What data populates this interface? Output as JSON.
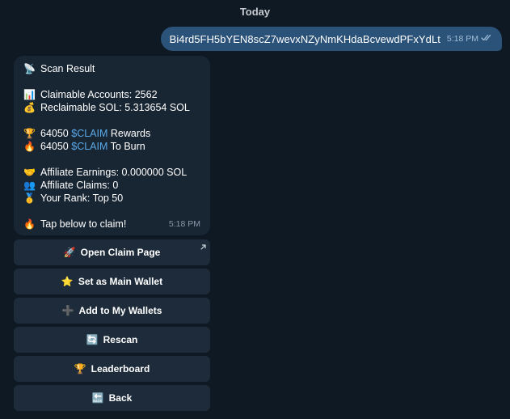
{
  "date_separator": "Today",
  "outgoing": {
    "text": "Bi4rd5FH5bYEN8scZ7wevxNZyNmKHdaBcvewdPFxYdLt",
    "time": "5:18 PM"
  },
  "incoming": {
    "time": "5:18 PM",
    "title": {
      "icon": "📡",
      "text": "Scan Result"
    },
    "accounts": {
      "icon": "📊",
      "text": "Claimable Accounts: 2562"
    },
    "sol": {
      "icon": "💰",
      "text": "Reclaimable SOL: 5.313654 SOL"
    },
    "rewards": {
      "icon": "🏆",
      "amount": "64050",
      "token": "$CLAIM",
      "suffix": "Rewards"
    },
    "burn": {
      "icon": "🔥",
      "amount": "64050",
      "token": "$CLAIM",
      "suffix": "To Burn"
    },
    "affiliate_earnings": {
      "icon": "🤝",
      "text": "Affiliate Earnings: 0.000000 SOL"
    },
    "affiliate_claims": {
      "icon": "👥",
      "text": "Affiliate Claims: 0"
    },
    "rank": {
      "icon": "🥇",
      "text": "Your Rank: Top 50"
    },
    "cta": {
      "icon": "🔥",
      "text": "Tap below to claim!"
    }
  },
  "keyboard": [
    {
      "icon": "🚀",
      "label": "Open Claim Page"
    },
    {
      "icon": "⭐",
      "label": "Set as Main Wallet"
    },
    {
      "icon": "➕",
      "label": "Add to My Wallets"
    },
    {
      "icon": "🔄",
      "label": "Rescan"
    },
    {
      "icon": "🏆",
      "label": "Leaderboard"
    },
    {
      "icon": "🔙",
      "label": "Back"
    }
  ],
  "icons": {
    "read_receipt": "double-check-icon",
    "external_link": "arrow-up-right-icon"
  },
  "colors": {
    "background": "#0f1923",
    "outgoing_bubble": "#2b5278",
    "incoming_bubble": "#182533",
    "keyboard_button": "#1d2b3a",
    "link": "#5aa9ea"
  }
}
